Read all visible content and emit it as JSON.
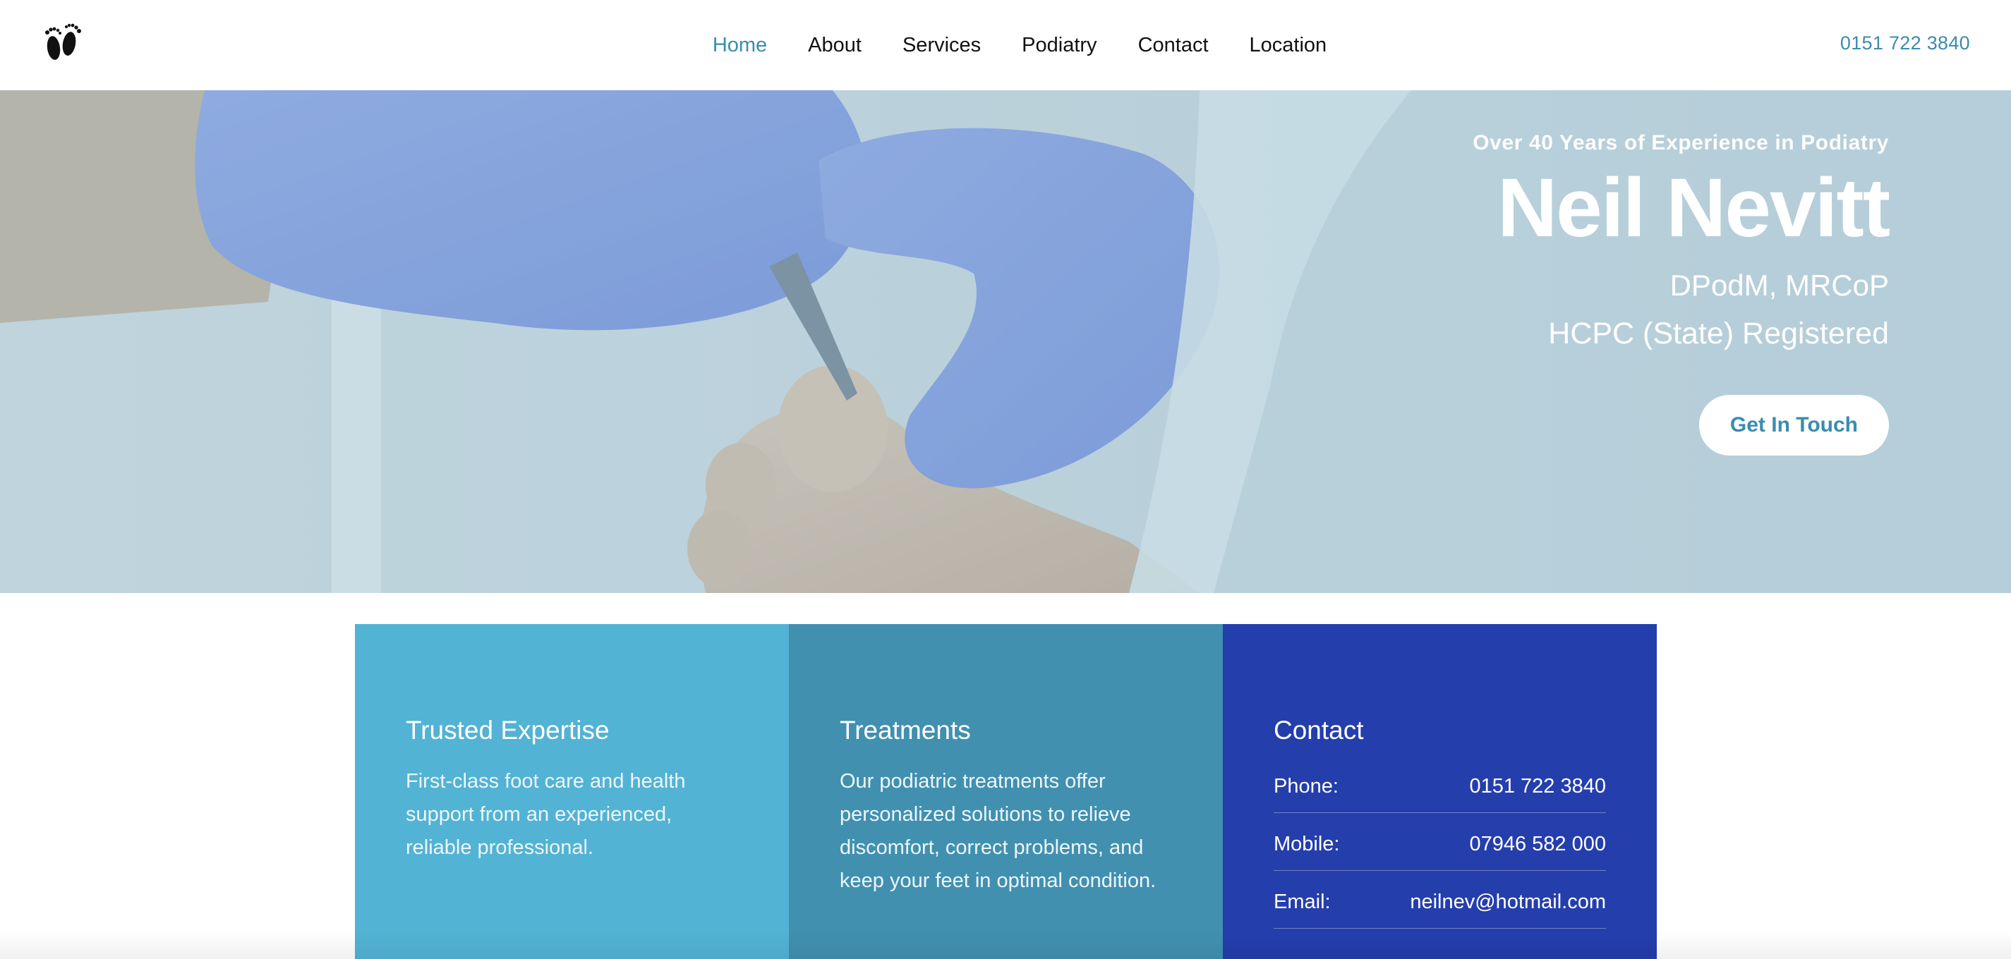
{
  "nav": {
    "items": [
      {
        "label": "Home",
        "active": true
      },
      {
        "label": "About",
        "active": false
      },
      {
        "label": "Services",
        "active": false
      },
      {
        "label": "Podiatry",
        "active": false
      },
      {
        "label": "Contact",
        "active": false
      },
      {
        "label": "Location",
        "active": false
      }
    ],
    "phone": "0151 722 3840",
    "logo_icon": "feet-icon"
  },
  "hero": {
    "eyebrow": "Over 40 Years of Experience in Podiatry",
    "name": "Neil Nevitt",
    "credentials": "DPodM, MRCoP",
    "registration": "HCPC (State) Registered",
    "cta_label": "Get In Touch"
  },
  "cards": {
    "expertise": {
      "title": "Trusted Expertise",
      "text": "First-class foot care and health support from an experienced, reliable professional."
    },
    "treatments": {
      "title": "Treatments",
      "text": "Our podiatric treatments offer personalized solutions to relieve discomfort, correct problems, and keep your feet in optimal condition."
    },
    "contact": {
      "title": "Contact",
      "rows": [
        {
          "label": "Phone:",
          "value": "0151 722 3840"
        },
        {
          "label": "Mobile:",
          "value": "07946 582 000"
        },
        {
          "label": "Email:",
          "value": "neilnev@hotmail.com"
        }
      ]
    }
  },
  "colors": {
    "accent": "#3a8cb0",
    "card1": "#52b3d4",
    "card2": "#4190b0",
    "card3": "#243eac"
  }
}
